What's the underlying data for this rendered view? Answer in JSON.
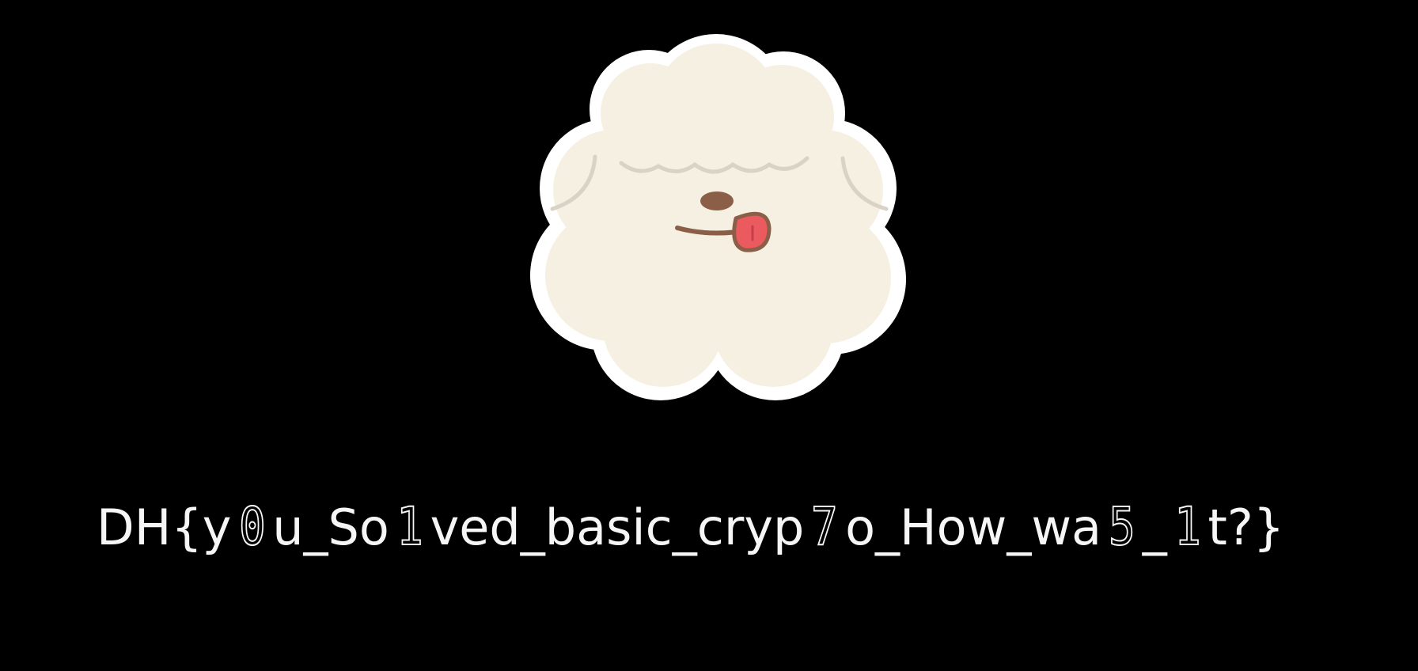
{
  "colors": {
    "background": "#000000",
    "sheep_fill": "#f6f0e3",
    "sheep_outline": "#ffffff",
    "text": "#f6f6f6",
    "tongue": "#ea5a5f",
    "nose": "#8b5e47"
  },
  "image": {
    "subject": "sheep-face-sticker"
  },
  "flag": {
    "seg1": "DH{y",
    "seg2": "0",
    "seg3": "u_So",
    "seg4": "1",
    "seg5": "ved_basic_cryp",
    "seg6": "7",
    "seg7": "o_How_wa",
    "seg8": "5",
    "seg9": "_",
    "seg10": "1",
    "seg11": "t?}"
  }
}
